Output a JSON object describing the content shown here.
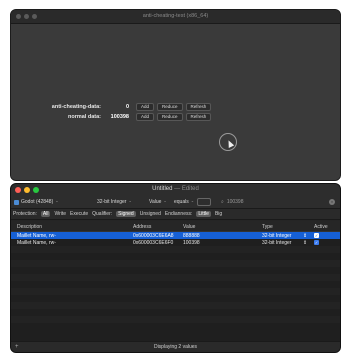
{
  "game_window": {
    "title": "anti-cheating-test (x86_64)",
    "rows": [
      {
        "label": "anti-cheating-data:",
        "value": "0",
        "buttons": [
          "Add",
          "Reduce",
          "Refresh"
        ]
      },
      {
        "label": "normal data:",
        "value": "100398",
        "buttons": [
          "Add",
          "Reduce",
          "Refresh"
        ]
      }
    ]
  },
  "slicer_window": {
    "title": "Untitled",
    "edited": "— Edited",
    "toolbar": {
      "process": "Godot (42848)",
      "data_type": "32-bit Integer",
      "variable": "Value",
      "operator": "equals",
      "search_value": "100398"
    },
    "scope": {
      "protection_label": "Protection:",
      "protection_options": [
        "All",
        "Write",
        "Execute"
      ],
      "qualifier_label": "Qualifier:",
      "qualifier_options": [
        "Signed",
        "Unsigned"
      ],
      "endianness_label": "Endianness:",
      "endianness_options": [
        "Little",
        "Big"
      ]
    },
    "table": {
      "headers": [
        "Description",
        "Address",
        "Value",
        "Type",
        "Active"
      ],
      "rows": [
        {
          "description": "Maillet Name, rw-",
          "address": "0x600003C6E6A8",
          "value": "888888",
          "type": "32-bit Integer",
          "active": true,
          "selected": true
        },
        {
          "description": "Maillet Name, rw-",
          "address": "0x600003C6E6F0",
          "value": "100398",
          "type": "32-bit Integer",
          "active": true,
          "selected": false
        }
      ]
    },
    "status": "Displaying 2 values",
    "colors": {
      "selection": "#1660d6",
      "close": "#ff5f57",
      "minimize": "#febc2e",
      "zoom": "#28c840"
    }
  }
}
